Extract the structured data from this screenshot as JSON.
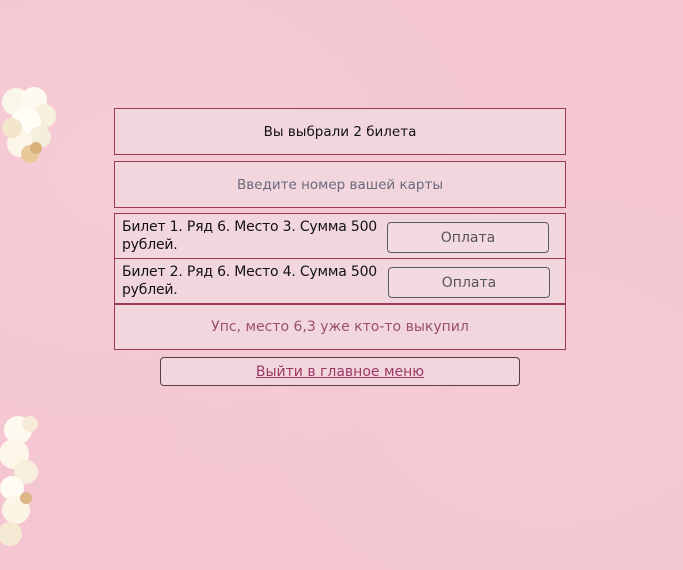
{
  "header": {
    "selected_text": "Вы выбрали 2 билета"
  },
  "card_input": {
    "placeholder": "Введите номер вашей карты",
    "value": ""
  },
  "tickets": [
    {
      "info": "Билет 1. Ряд 6. Место 3. Сумма 500 рублей.",
      "pay_label": "Оплата"
    },
    {
      "info": "Билет 2. Ряд 6. Место 4. Сумма 500 рублей.",
      "pay_label": "Оплата"
    }
  ],
  "error": {
    "message": "Упс, место 6,3 уже кто-то выкупил"
  },
  "exit": {
    "label": "Выйти в главное меню"
  },
  "colors": {
    "background": "#f4c6d1",
    "panel": "#f2d6de",
    "border": "#9b3a54",
    "error_text": "#9a4f6c",
    "link_text": "#9b3a64"
  },
  "decorations": [
    "popcorn-image",
    "popcorn-image"
  ]
}
